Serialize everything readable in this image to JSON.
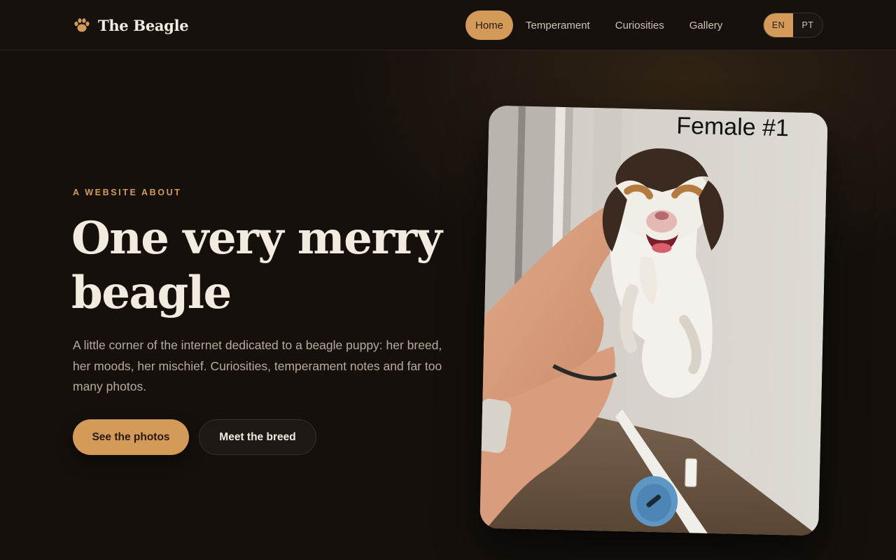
{
  "brand": {
    "name": "The Beagle",
    "icon": "paw-icon",
    "accent": "#d49a5a"
  },
  "nav": {
    "items": [
      {
        "label": "Home",
        "active": true
      },
      {
        "label": "Temperament",
        "active": false
      },
      {
        "label": "Curiosities",
        "active": false
      },
      {
        "label": "Gallery",
        "active": false
      }
    ]
  },
  "lang": {
    "options": [
      "EN",
      "PT"
    ],
    "selected": "EN"
  },
  "hero": {
    "eyebrow": "A WEBSITE ABOUT",
    "title": "One very merry beagle",
    "lede": "A little corner of the internet dedicated to a beagle puppy: her breed, her moods, her mischief. Curiosities, temperament notes and far too many photos.",
    "primary_cta": "See the photos",
    "secondary_cta": "Meet the breed"
  },
  "photo": {
    "caption_text": "Female #1"
  },
  "colors": {
    "background": "#15100c",
    "accent": "#d49a5a",
    "text": "#f3ebe0",
    "muted": "#b9ab9b"
  }
}
